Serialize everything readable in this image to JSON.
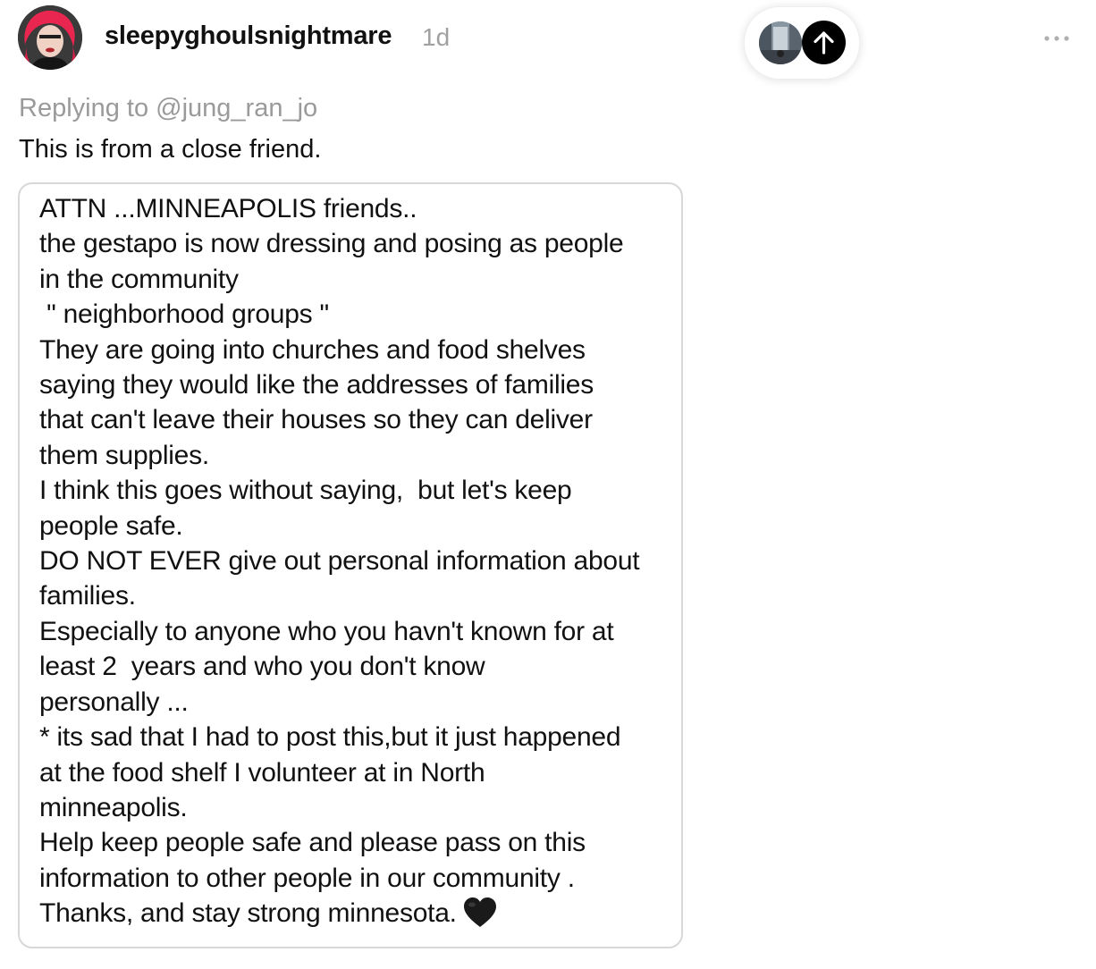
{
  "post": {
    "username": "sleepyghoulsnightmare",
    "time_ago": "1d",
    "replying_to": "Replying to @jung_ran_jo",
    "caption": "This is from a close friend.",
    "image_text_lines": [
      "ATTN ...MINNEAPOLIS friends..",
      "the gestapo is now dressing and posing as people",
      "in the community",
      " \" neighborhood groups \"",
      "They are going into churches and food shelves",
      "saying they would like the addresses of families",
      "that can't leave their houses so they can deliver",
      "them supplies.",
      "I think this goes without saying,  but let's keep",
      "people safe.",
      "DO NOT EVER give out personal information about",
      "families.",
      "Especially to anyone who you havn't known for at",
      "least 2  years and who you don't know",
      "personally ...",
      "* its sad that I had to post this,but it just happened",
      "at the food shelf I volunteer at in North",
      "minneapolis.",
      "Help keep people safe and please pass on this",
      "information to other people in our community .",
      "Thanks, and stay strong minnesota."
    ]
  },
  "icons": {
    "heart": "black-heart-icon",
    "up_arrow": "arrow-up-icon",
    "more": "more-horizontal-icon"
  },
  "colors": {
    "muted_text": "#9a9a9a",
    "card_border": "#d8d8d8",
    "up_button_bg": "#000000",
    "heart": "#1a1a1a"
  }
}
